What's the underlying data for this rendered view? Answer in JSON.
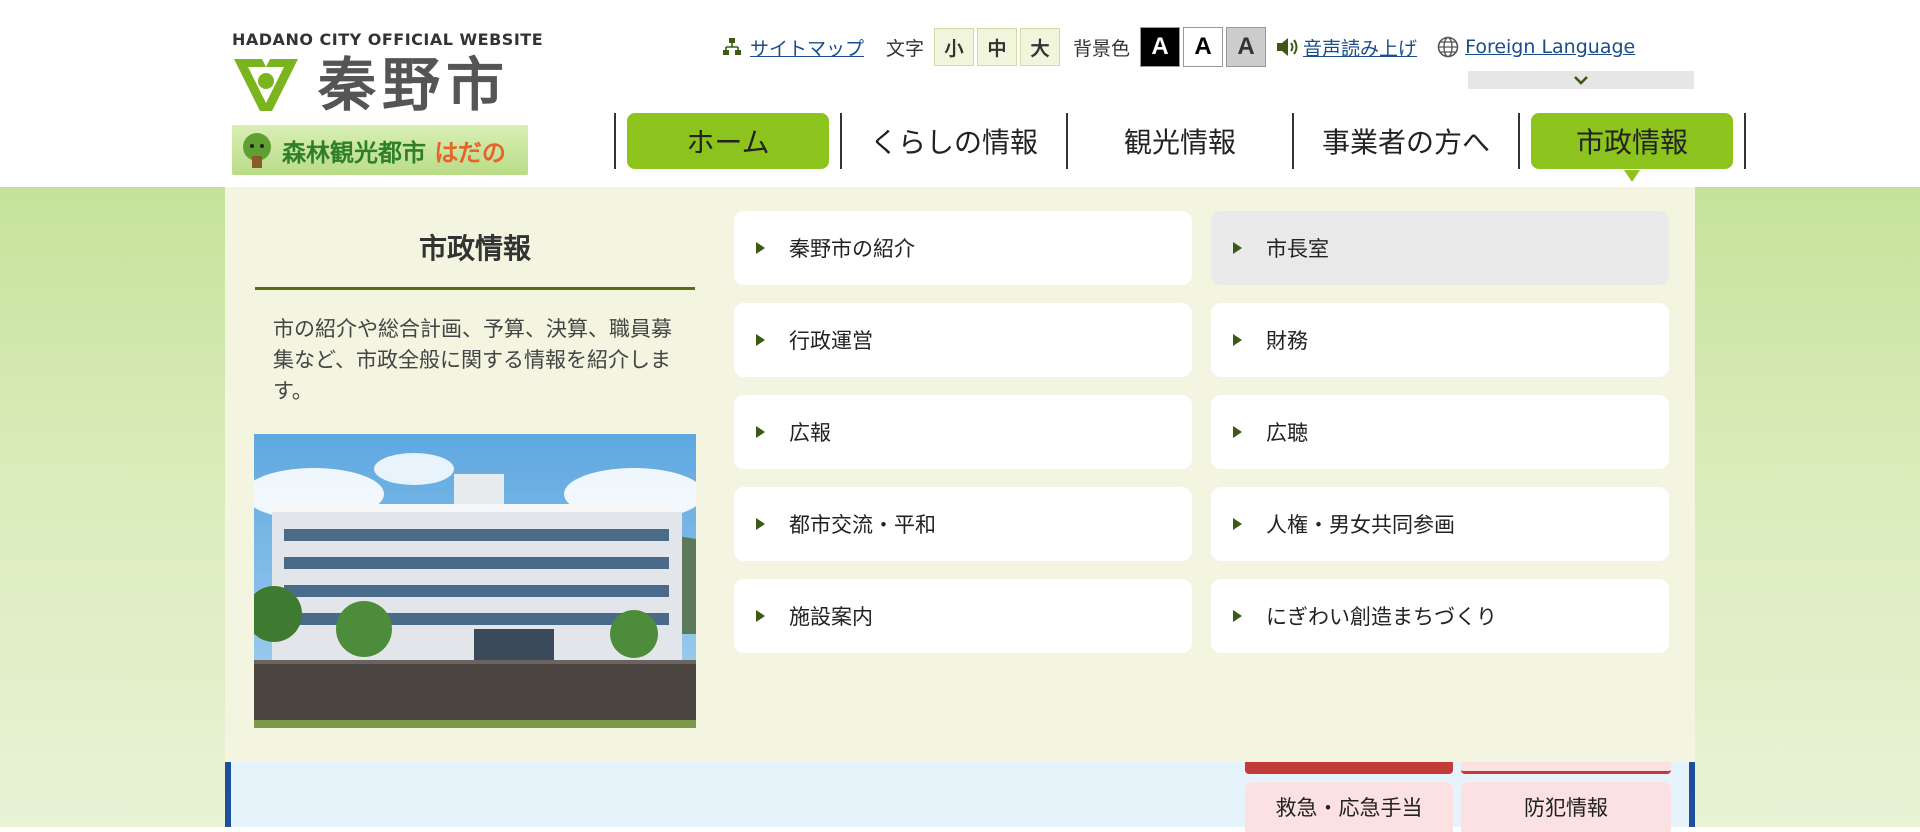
{
  "header": {
    "logo_en": "HADANO CITY OFFICIAL WEBSITE",
    "logo_ja": "秦野市",
    "banner_prefix": "森林観光都市",
    "banner_highlight": "はだの"
  },
  "utility": {
    "sitemap": "サイトマップ",
    "font_size_label": "文字",
    "font_sizes": [
      "小",
      "中",
      "大"
    ],
    "bg_color_label": "背景色",
    "bg_color_options": [
      "A",
      "A",
      "A"
    ],
    "read_aloud": "音声読み上げ",
    "foreign_language": "Foreign Language"
  },
  "nav": {
    "items": [
      {
        "label": "ホーム"
      },
      {
        "label": "くらしの情報"
      },
      {
        "label": "観光情報"
      },
      {
        "label": "事業者の方へ"
      },
      {
        "label": "市政情報"
      }
    ]
  },
  "panel": {
    "title": "市政情報",
    "description": "市の紹介や総合計画、予算、決算、職員募集など、市政全般に関する情報を紹介します。",
    "links": [
      {
        "label": "秦野市の紹介"
      },
      {
        "label": "市長室"
      },
      {
        "label": "行政運営"
      },
      {
        "label": "財務"
      },
      {
        "label": "広報"
      },
      {
        "label": "広聴"
      },
      {
        "label": "都市交流・平和"
      },
      {
        "label": "人権・男女共同参画"
      },
      {
        "label": "施設案内"
      },
      {
        "label": "にぎわい創造まちづくり"
      }
    ]
  },
  "below": {
    "emergency_tabs": [
      "救急・応急手当",
      "防犯情報"
    ]
  },
  "colors": {
    "accent_green": "#8cc41d",
    "link_blue": "#1a4d8a",
    "panel_bg": "#f4f5e0"
  }
}
